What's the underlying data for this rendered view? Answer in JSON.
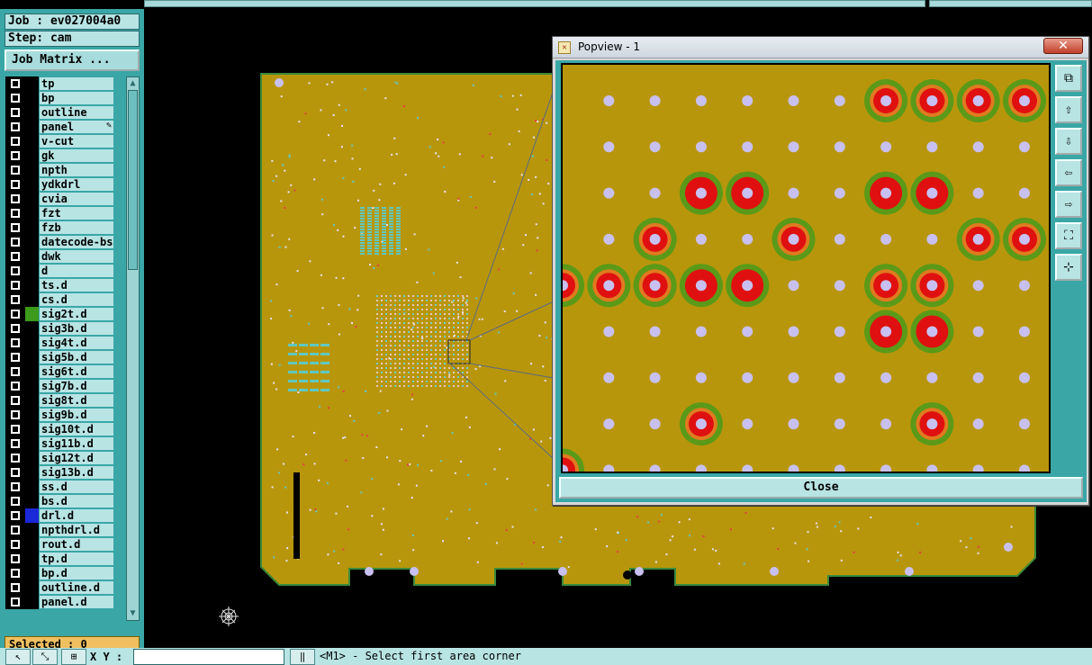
{
  "job_label": "Job : ev027004a0",
  "step_label": "Step: cam",
  "job_matrix_button": "Job Matrix ...",
  "layers": [
    {
      "name": "tp",
      "color": ""
    },
    {
      "name": "bp",
      "color": ""
    },
    {
      "name": "outline",
      "color": ""
    },
    {
      "name": "panel",
      "color": "",
      "mark": "✎"
    },
    {
      "name": "v-cut",
      "color": ""
    },
    {
      "name": "gk",
      "color": ""
    },
    {
      "name": "npth",
      "color": ""
    },
    {
      "name": "ydkdrl",
      "color": ""
    },
    {
      "name": "cvia",
      "color": ""
    },
    {
      "name": "fzt",
      "color": ""
    },
    {
      "name": "fzb",
      "color": ""
    },
    {
      "name": "datecode-bs",
      "color": ""
    },
    {
      "name": "dwk",
      "color": ""
    },
    {
      "name": "d",
      "color": ""
    },
    {
      "name": "ts.d",
      "color": ""
    },
    {
      "name": "cs.d",
      "color": ""
    },
    {
      "name": "sig2t.d",
      "color": "#3c9a1c"
    },
    {
      "name": "sig3b.d",
      "color": ""
    },
    {
      "name": "sig4t.d",
      "color": ""
    },
    {
      "name": "sig5b.d",
      "color": ""
    },
    {
      "name": "sig6t.d",
      "color": ""
    },
    {
      "name": "sig7b.d",
      "color": ""
    },
    {
      "name": "sig8t.d",
      "color": ""
    },
    {
      "name": "sig9b.d",
      "color": ""
    },
    {
      "name": "sig10t.d",
      "color": ""
    },
    {
      "name": "sig11b.d",
      "color": ""
    },
    {
      "name": "sig12t.d",
      "color": ""
    },
    {
      "name": "sig13b.d",
      "color": ""
    },
    {
      "name": "ss.d",
      "color": ""
    },
    {
      "name": "bs.d",
      "color": ""
    },
    {
      "name": "drl.d",
      "color": "#1a28d8"
    },
    {
      "name": "npthdrl.d",
      "color": ""
    },
    {
      "name": "rout.d",
      "color": ""
    },
    {
      "name": "tp.d",
      "color": ""
    },
    {
      "name": "bp.d",
      "color": ""
    },
    {
      "name": "outline.d",
      "color": ""
    },
    {
      "name": "panel.d",
      "color": ""
    }
  ],
  "selected_label": "Selected : 0",
  "xy_label": "X Y :",
  "xy_value": "",
  "status_message": "<M1> - Select first area corner",
  "popview": {
    "title": "Popview - 1",
    "close_x": "✕",
    "close_button": "Close",
    "tools": [
      "zoom-fit-icon",
      "pan-up-icon",
      "pan-down-icon",
      "pan-left-icon",
      "pan-right-icon",
      "zoom-in-icon",
      "zoom-out-icon"
    ]
  },
  "colors": {
    "board": "#b8960c",
    "panel_bg": "#3aa6a6",
    "field_bg": "#b8e4e4",
    "pad_ring_green": "#5a9a18",
    "pad_ring_orange": "#e07a20",
    "pad_red": "#e01010",
    "via": "#c8c0f0"
  }
}
